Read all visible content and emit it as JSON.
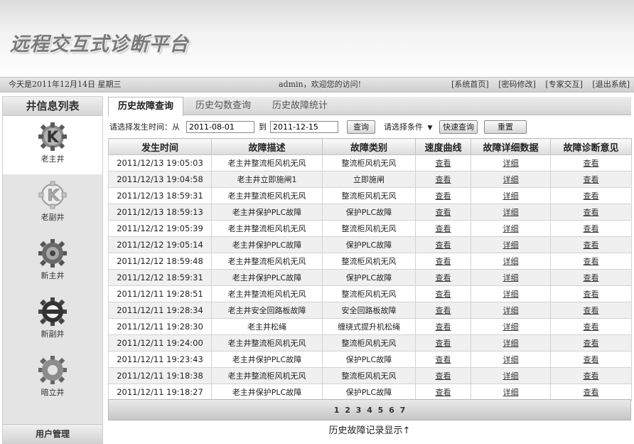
{
  "app": {
    "title": "远程交互式诊断平台"
  },
  "status": {
    "date": "今天是2011年12月14日 星期三",
    "welcome": "admin，欢迎您的访问!",
    "links": [
      "[系统首页]",
      "[密码修改]",
      "[专家交互]",
      "[退出系统]"
    ]
  },
  "sidebar": {
    "header": "井信息列表",
    "items": [
      {
        "label": "老主井",
        "icon": "k-gear-icon",
        "active": true
      },
      {
        "label": "老副井",
        "icon": "k-gear-outline-icon",
        "active": false
      },
      {
        "label": "新主井",
        "icon": "gear-icon",
        "active": false
      },
      {
        "label": "新副井",
        "icon": "gear-wrench-icon",
        "active": false
      },
      {
        "label": "暗立井",
        "icon": "gear-icon",
        "active": false
      }
    ],
    "footer": "用户管理"
  },
  "tabs": [
    "历史故障查询",
    "历史勾数查询",
    "历史故障统计"
  ],
  "filter": {
    "label": "请选择发生时间：从",
    "from": "2011-08-01",
    "to_label": "到",
    "to": "2011-12-15",
    "query_button": "查询",
    "condition_select": "请选择条件",
    "quick_query_button": "快速查询",
    "reset_button": "重置"
  },
  "table": {
    "columns": [
      "发生时间",
      "故障描述",
      "故障类别",
      "速度曲线",
      "故障详细数据",
      "故障诊断意见"
    ],
    "rows": [
      [
        "2011/12/13 19:05:03",
        "老主井整流柜风机无风",
        "整流柜风机无风",
        "查看",
        "详细",
        "查看"
      ],
      [
        "2011/12/13 19:04:58",
        "老主井立即施闸1",
        "立即施闸",
        "查看",
        "详细",
        "查看"
      ],
      [
        "2011/12/13 18:59:31",
        "老主井整流柜风机无风",
        "整流柜风机无风",
        "查看",
        "详细",
        "查看"
      ],
      [
        "2011/12/13 18:59:13",
        "老主井保护PLC故障",
        "保护PLC故障",
        "查看",
        "详细",
        "查看"
      ],
      [
        "2011/12/12 19:05:39",
        "老主井整流柜风机无风",
        "整流柜风机无风",
        "查看",
        "详细",
        "查看"
      ],
      [
        "2011/12/12 19:05:14",
        "老主井保护PLC故障",
        "保护PLC故障",
        "查看",
        "详细",
        "查看"
      ],
      [
        "2011/12/12 18:59:48",
        "老主井整流柜风机无风",
        "整流柜风机无风",
        "查看",
        "详细",
        "查看"
      ],
      [
        "2011/12/12 18:59:31",
        "老主井保护PLC故障",
        "保护PLC故障",
        "查看",
        "详细",
        "查看"
      ],
      [
        "2011/12/11 19:28:51",
        "老主井整流柜风机无风",
        "整流柜风机无风",
        "查看",
        "详细",
        "查看"
      ],
      [
        "2011/12/11 19:28:34",
        "老主井安全回路板故障",
        "安全回路板故障",
        "查看",
        "详细",
        "查看"
      ],
      [
        "2011/12/11 19:28:30",
        "老主井松绳",
        "缠绕式提升机松绳",
        "查看",
        "详细",
        "查看"
      ],
      [
        "2011/12/11 19:24:00",
        "老主井整流柜风机无风",
        "整流柜风机无风",
        "查看",
        "详细",
        "查看"
      ],
      [
        "2011/12/11 19:23:43",
        "老主井保护PLC故障",
        "保护PLC故障",
        "查看",
        "详细",
        "查看"
      ],
      [
        "2011/12/11 19:18:38",
        "老主井整流柜风机无风",
        "整流柜风机无风",
        "查看",
        "详细",
        "查看"
      ],
      [
        "2011/12/11 19:18:27",
        "老主井保护PLC故障",
        "保护PLC故障",
        "查看",
        "详细",
        "查看"
      ]
    ]
  },
  "pager": "1 2 3 4 5 6 7",
  "caption": "历史故障记录显示↑"
}
